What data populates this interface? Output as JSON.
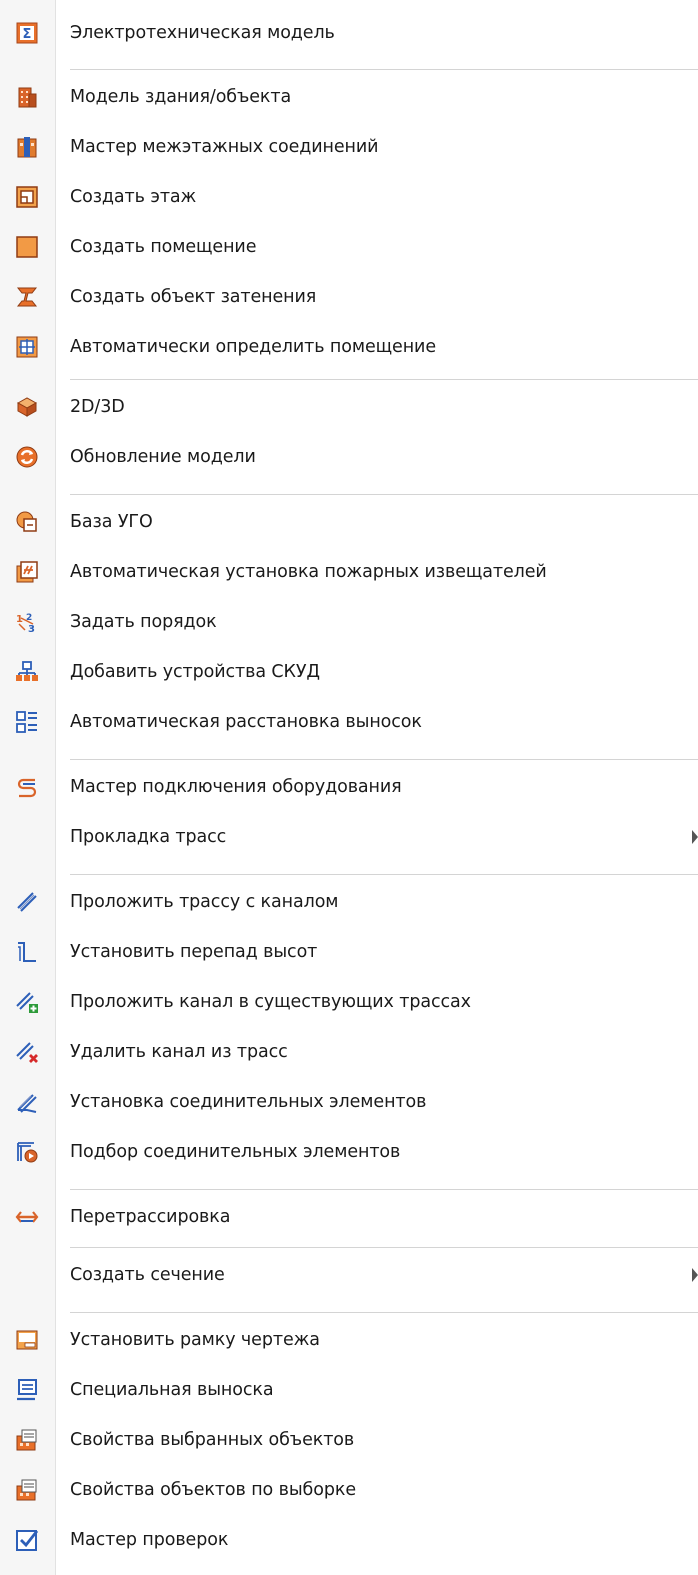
{
  "menu": {
    "items": [
      {
        "label": "Электротехническая модель",
        "icon": "electrical-model-icon"
      },
      {
        "label": "Модель здания/объекта",
        "icon": "building-model-icon"
      },
      {
        "label": "Мастер межэтажных соединений",
        "icon": "interfloor-connections-icon"
      },
      {
        "label": "Создать этаж",
        "icon": "create-floor-icon"
      },
      {
        "label": "Создать помещение",
        "icon": "create-room-icon"
      },
      {
        "label": "Создать объект затенения",
        "icon": "shading-object-icon"
      },
      {
        "label": "Автоматически определить помещение",
        "icon": "auto-detect-room-icon"
      },
      {
        "label": "2D/3D",
        "icon": "2d-3d-icon"
      },
      {
        "label": "Обновление модели",
        "icon": "refresh-model-icon"
      },
      {
        "label": "База УГО",
        "icon": "symbol-database-icon"
      },
      {
        "label": "Автоматическая установка пожарных извещателей",
        "icon": "fire-detectors-icon"
      },
      {
        "label": "Задать порядок",
        "icon": "set-order-icon"
      },
      {
        "label": "Добавить устройства СКУД",
        "icon": "access-control-devices-icon"
      },
      {
        "label": "Автоматическая расстановка выносок",
        "icon": "auto-callouts-icon"
      },
      {
        "label": "Мастер подключения оборудования",
        "icon": "equipment-connection-icon"
      },
      {
        "label": "Прокладка трасс",
        "icon": "",
        "submenu": true
      },
      {
        "label": "Проложить трассу с каналом",
        "icon": "route-with-channel-icon"
      },
      {
        "label": "Установить перепад высот",
        "icon": "height-difference-icon"
      },
      {
        "label": "Проложить канал в существующих трассах",
        "icon": "add-channel-icon"
      },
      {
        "label": "Удалить канал из трасс",
        "icon": "remove-channel-icon"
      },
      {
        "label": "Установка соединительных элементов",
        "icon": "connecting-elements-icon"
      },
      {
        "label": "Подбор соединительных элементов",
        "icon": "select-connecting-elements-icon"
      },
      {
        "label": "Перетрассировка",
        "icon": "reroute-icon"
      },
      {
        "label": "Создать сечение",
        "icon": "",
        "submenu": true
      },
      {
        "label": "Установить рамку чертежа",
        "icon": "drawing-frame-icon"
      },
      {
        "label": "Специальная выноска",
        "icon": "special-callout-icon"
      },
      {
        "label": "Свойства выбранных объектов",
        "icon": "selected-properties-icon"
      },
      {
        "label": "Свойства объектов по выборке",
        "icon": "selection-properties-icon"
      },
      {
        "label": "Мастер проверок",
        "icon": "check-wizard-icon"
      }
    ]
  }
}
